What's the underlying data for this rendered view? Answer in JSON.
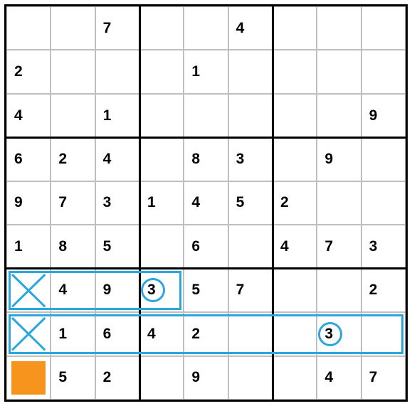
{
  "sudoku": {
    "grid": [
      [
        "",
        "",
        "7",
        "",
        "",
        "4",
        "",
        "",
        ""
      ],
      [
        "2",
        "",
        "",
        "",
        "1",
        "",
        "",
        "",
        ""
      ],
      [
        "4",
        "",
        "1",
        "",
        "",
        "",
        "",
        "",
        "9"
      ],
      [
        "6",
        "2",
        "4",
        "",
        "8",
        "3",
        "",
        "9",
        ""
      ],
      [
        "9",
        "7",
        "3",
        "1",
        "4",
        "5",
        "2",
        "",
        ""
      ],
      [
        "1",
        "8",
        "5",
        "",
        "6",
        "",
        "4",
        "7",
        "3"
      ],
      [
        "",
        "4",
        "9",
        "3",
        "5",
        "7",
        "",
        "",
        "2"
      ],
      [
        "",
        "1",
        "6",
        "4",
        "2",
        "",
        "",
        "3",
        ""
      ],
      [
        "",
        "5",
        "2",
        "",
        "9",
        "",
        "",
        "4",
        "7"
      ]
    ],
    "annotations": {
      "row_highlights": [
        {
          "row": 6,
          "col_start": 0,
          "col_end": 3
        },
        {
          "row": 7,
          "col_start": 0,
          "col_end": 8
        }
      ],
      "circles": [
        {
          "row": 6,
          "col": 3
        },
        {
          "row": 7,
          "col": 7
        }
      ],
      "x_marks": [
        {
          "row": 6,
          "col": 0
        },
        {
          "row": 7,
          "col": 0
        }
      ],
      "orange_cells": [
        {
          "row": 8,
          "col": 0
        }
      ]
    }
  },
  "colors": {
    "highlight": "#2aa7e0",
    "orange": "#f7941d"
  }
}
